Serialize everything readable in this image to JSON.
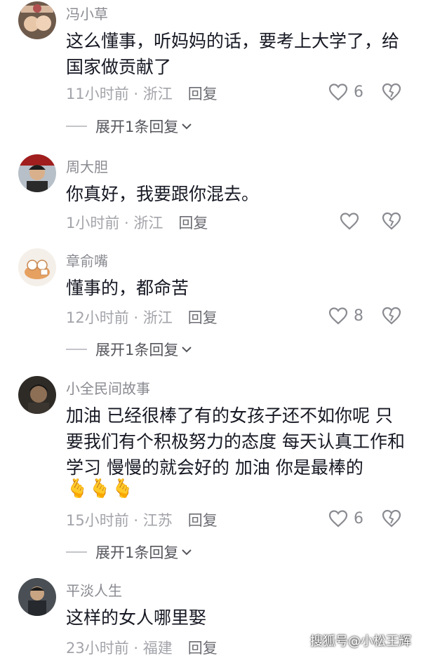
{
  "comments": [
    {
      "username": "冯小草",
      "text": "这么懂事，听妈妈的话，要考上大学了，给国家做贡献了",
      "time": "11小时前 · 浙江",
      "reply_label": "回复",
      "likes": "6",
      "expand_label": "展开1条回复"
    },
    {
      "username": "周大胆",
      "text": "你真好，我要跟你混去。",
      "time": "1小时前 · 浙江",
      "reply_label": "回复",
      "likes": ""
    },
    {
      "username": "章俞嘴",
      "text": "懂事的，都命苦",
      "time": "12小时前 · 浙江",
      "reply_label": "回复",
      "likes": "8",
      "expand_label": "展开1条回复"
    },
    {
      "username": "小全民间故事",
      "text": "加油 已经很棒了有的女孩子还不如你呢 只要我们有个积极努力的态度 每天认真工作和学习 慢慢的就会好的 加油 你是最棒的",
      "emojis": "🫰🫰🫰",
      "time": "15小时前 · 江苏",
      "reply_label": "回复",
      "likes": "6",
      "expand_label": "展开1条回复"
    },
    {
      "username": "平淡人生",
      "text": "这样的女人哪里娶",
      "time": "23小时前 · 福建",
      "reply_label": "回复",
      "likes": ""
    }
  ],
  "watermark": "搜狐号@小松王辉",
  "colors": {
    "text": "#161823",
    "username": "#8a8b91",
    "meta": "#a3a4aa",
    "reply": "#6c6d73",
    "icon": "#8a8b91"
  },
  "icons": {
    "like": "heart-outline-icon",
    "dislike": "broken-heart-icon",
    "expand": "chevron-down-icon"
  }
}
